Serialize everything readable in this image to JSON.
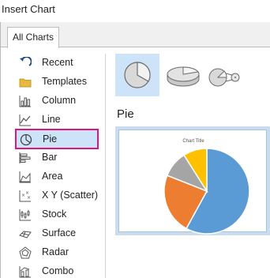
{
  "window": {
    "title": "Insert Chart"
  },
  "tabs": [
    {
      "label": "All Charts"
    }
  ],
  "sidebar": {
    "items": [
      {
        "label": "Recent",
        "icon": "recent-icon"
      },
      {
        "label": "Templates",
        "icon": "folder-icon"
      },
      {
        "label": "Column",
        "icon": "column-chart-icon"
      },
      {
        "label": "Line",
        "icon": "line-chart-icon"
      },
      {
        "label": "Pie",
        "icon": "pie-chart-icon",
        "selected": true
      },
      {
        "label": "Bar",
        "icon": "bar-chart-icon"
      },
      {
        "label": "Area",
        "icon": "area-chart-icon"
      },
      {
        "label": "X Y (Scatter)",
        "icon": "scatter-chart-icon"
      },
      {
        "label": "Stock",
        "icon": "stock-chart-icon"
      },
      {
        "label": "Surface",
        "icon": "surface-chart-icon"
      },
      {
        "label": "Radar",
        "icon": "radar-chart-icon"
      },
      {
        "label": "Combo",
        "icon": "combo-chart-icon"
      }
    ]
  },
  "chart_types": {
    "selected": "Pie",
    "thumbnails": [
      {
        "icon": "pie-icon",
        "selected": true
      },
      {
        "icon": "3d-pie-icon",
        "selected": false
      },
      {
        "icon": "pie-of-pie-icon",
        "selected": false
      }
    ]
  },
  "preview": {
    "heading": "Pie",
    "chart_title": "Chart Title"
  },
  "chart_data": {
    "type": "pie",
    "title": "Chart Title",
    "values": [
      58,
      23,
      10,
      9
    ],
    "colors": [
      "#5b9bd5",
      "#ed7d31",
      "#a5a5a5",
      "#ffc000"
    ]
  },
  "colors": {
    "selection_fill": "#cde3f7",
    "selection_border": "#e0157f",
    "preview_frame": "#c9dcf0"
  }
}
